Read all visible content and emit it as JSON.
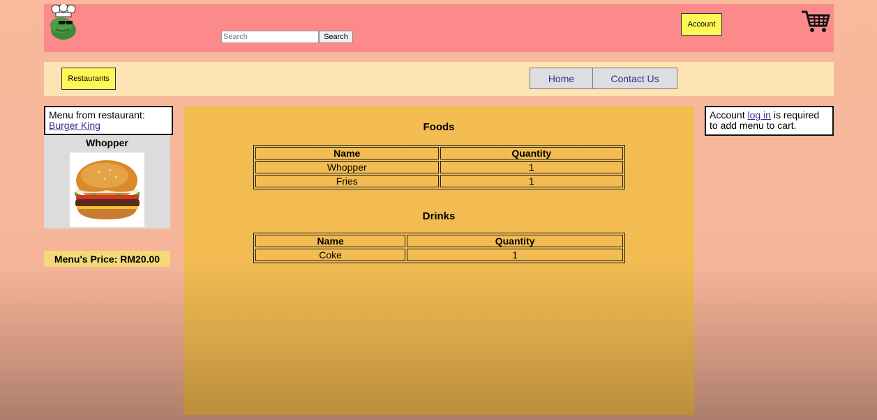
{
  "header": {
    "search_placeholder": "Search",
    "search_button": "Search",
    "account_button": "Account"
  },
  "nav": {
    "restaurants_button": "Restaurants",
    "tabs": [
      {
        "label": "Home"
      },
      {
        "label": "Contact Us"
      }
    ]
  },
  "sidebar": {
    "menu_from_label": "Menu from restaurant:",
    "restaurant_name": "Burger King",
    "item_name": "Whopper",
    "price_text": "Menu's Price: RM20.00"
  },
  "main": {
    "foods": {
      "title": "Foods",
      "headers": [
        "Name",
        "Quantity"
      ],
      "rows": [
        {
          "name": "Whopper",
          "quantity": "1"
        },
        {
          "name": "Fries",
          "quantity": "1"
        }
      ]
    },
    "drinks": {
      "title": "Drinks",
      "headers": [
        "Name",
        "Quantity"
      ],
      "rows": [
        {
          "name": "Coke",
          "quantity": "1"
        }
      ]
    }
  },
  "login_notice": {
    "prefix": "Account ",
    "link": "log in",
    "suffix": " is required to add menu to cart."
  },
  "colors": {
    "header_bg": "#fc8a8b",
    "nav_bg": "#fee4b4",
    "button_yellow": "#fef856",
    "main_bg": "#f3bd52",
    "link": "#3b2a8a"
  }
}
